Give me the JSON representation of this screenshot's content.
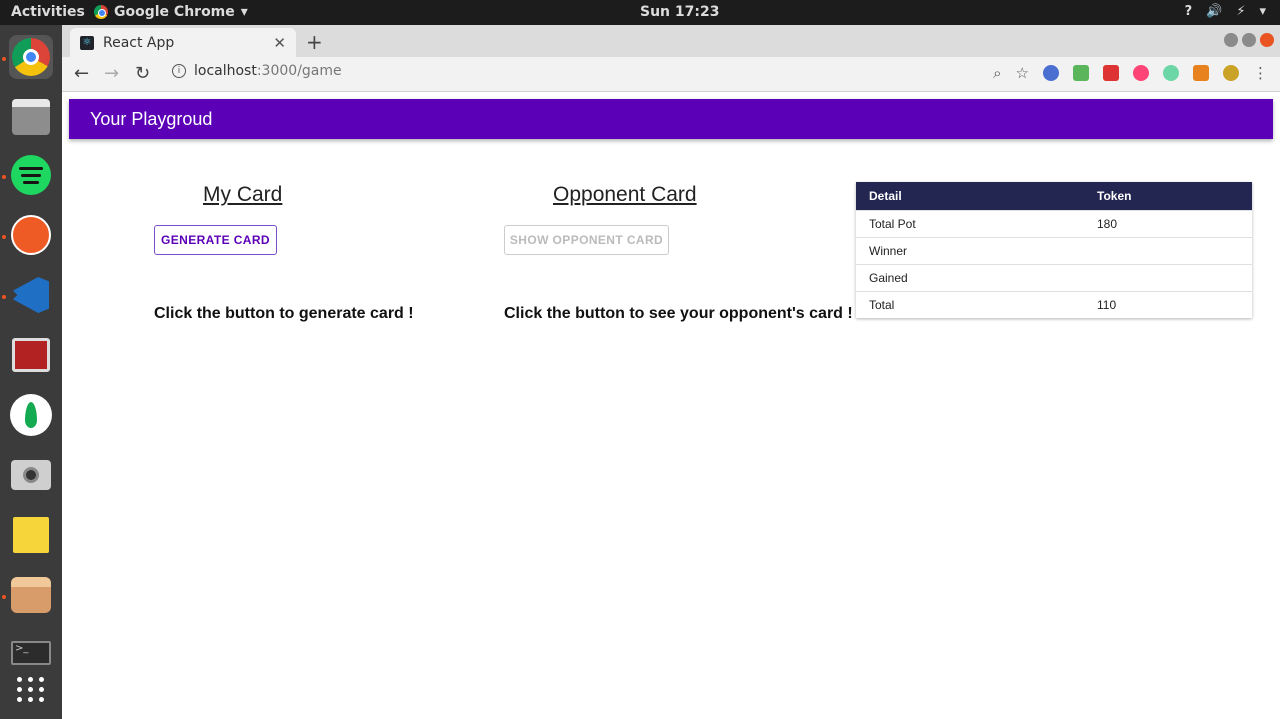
{
  "system": {
    "activities": "Activities",
    "app_name": "Google Chrome",
    "clock": "Sun 17:23",
    "tray": [
      "?",
      "🔊",
      "⚡",
      "▾"
    ]
  },
  "dock": {
    "items": [
      "chrome",
      "files",
      "spotify",
      "postman",
      "vscode",
      "terminal-app",
      "mongodb",
      "camera",
      "notes",
      "app",
      "terminal",
      "show-apps"
    ]
  },
  "browser": {
    "tab_title": "React App",
    "url_host": "localhost",
    "url_path": ":3000/game"
  },
  "app": {
    "title": "Your Playgroud",
    "my_card": {
      "heading": "My Card",
      "button": "GENERATE CARD",
      "message": "Click the button to generate card !"
    },
    "opponent_card": {
      "heading": "Opponent Card",
      "button": "SHOW OPPONENT CARD",
      "message": "Click the button to see your opponent's card !"
    },
    "table": {
      "headers": [
        "Detail",
        "Token"
      ],
      "rows": [
        {
          "detail": "Total Pot",
          "token": "180"
        },
        {
          "detail": "Winner",
          "token": ""
        },
        {
          "detail": "Gained",
          "token": ""
        },
        {
          "detail": "Total",
          "token": "110"
        }
      ]
    }
  }
}
